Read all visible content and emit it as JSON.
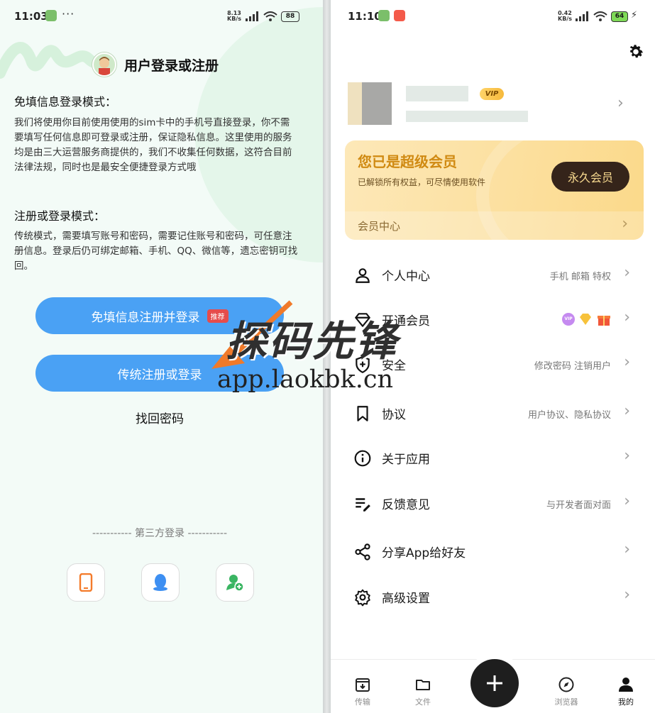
{
  "left": {
    "status": {
      "time": "11:03",
      "net_top": "8.13",
      "net_bottom": "KB/s",
      "battery": "88",
      "more": "···"
    },
    "title": "用户登录或注册",
    "section1_title": "免填信息登录模式：",
    "section1_text": "我们将使用你目前使用使用的sim卡中的手机号直接登录，你不需要填写任何信息即可登录或注册，保证隐私信息。这里使用的服务均是由三大运营服务商提供的，我们不收集任何数据，这符合目前法律法规，同时也是最安全便捷登录方式哦",
    "section2_title": "注册或登录模式：",
    "section2_text": "传统模式，需要填写账号和密码，需要记住账号和密码，可任意注册信息。登录后仍可绑定邮箱、手机、QQ、微信等，遗忘密钥可找回。",
    "btn_quick": "免填信息注册并登录",
    "btn_quick_tag": "推荐",
    "btn_traditional": "传统注册或登录",
    "forgot": "找回密码",
    "third_party": "----------- 第三方登录 -----------"
  },
  "right": {
    "status": {
      "time": "11:10",
      "net_top": "0.42",
      "net_bottom": "KB/s",
      "battery": "64"
    },
    "vip_badge": "VIP",
    "vip_card": {
      "title": "您已是超级会员",
      "subtitle": "已解锁所有权益，可尽情使用软件",
      "button": "永久会员",
      "center": "会员中心"
    },
    "menu": [
      {
        "label": "个人中心",
        "sub": "手机 邮箱 特权"
      },
      {
        "label": "开通会员",
        "sub": ""
      },
      {
        "label": "安全",
        "sub": "修改密码  注销用户"
      },
      {
        "label": "协议",
        "sub": "用户协议、隐私协议"
      },
      {
        "label": "关于应用",
        "sub": ""
      },
      {
        "label": "反馈意见",
        "sub": "与开发者面对面"
      },
      {
        "label": "分享App给好友",
        "sub": ""
      },
      {
        "label": "高级设置",
        "sub": ""
      }
    ],
    "vip_mini_badge": "VIP",
    "nav": {
      "transfer": "传输",
      "files": "文件",
      "browser": "浏览器",
      "mine": "我的"
    }
  },
  "watermark": {
    "line1": "探码先锋",
    "line2": "app.laokbk.cn"
  },
  "colors": {
    "primary_blue": "#4aa1f4",
    "vip_gold": "#d08a12",
    "vip_dark": "#35241a",
    "tag_red": "#e64c4c"
  }
}
